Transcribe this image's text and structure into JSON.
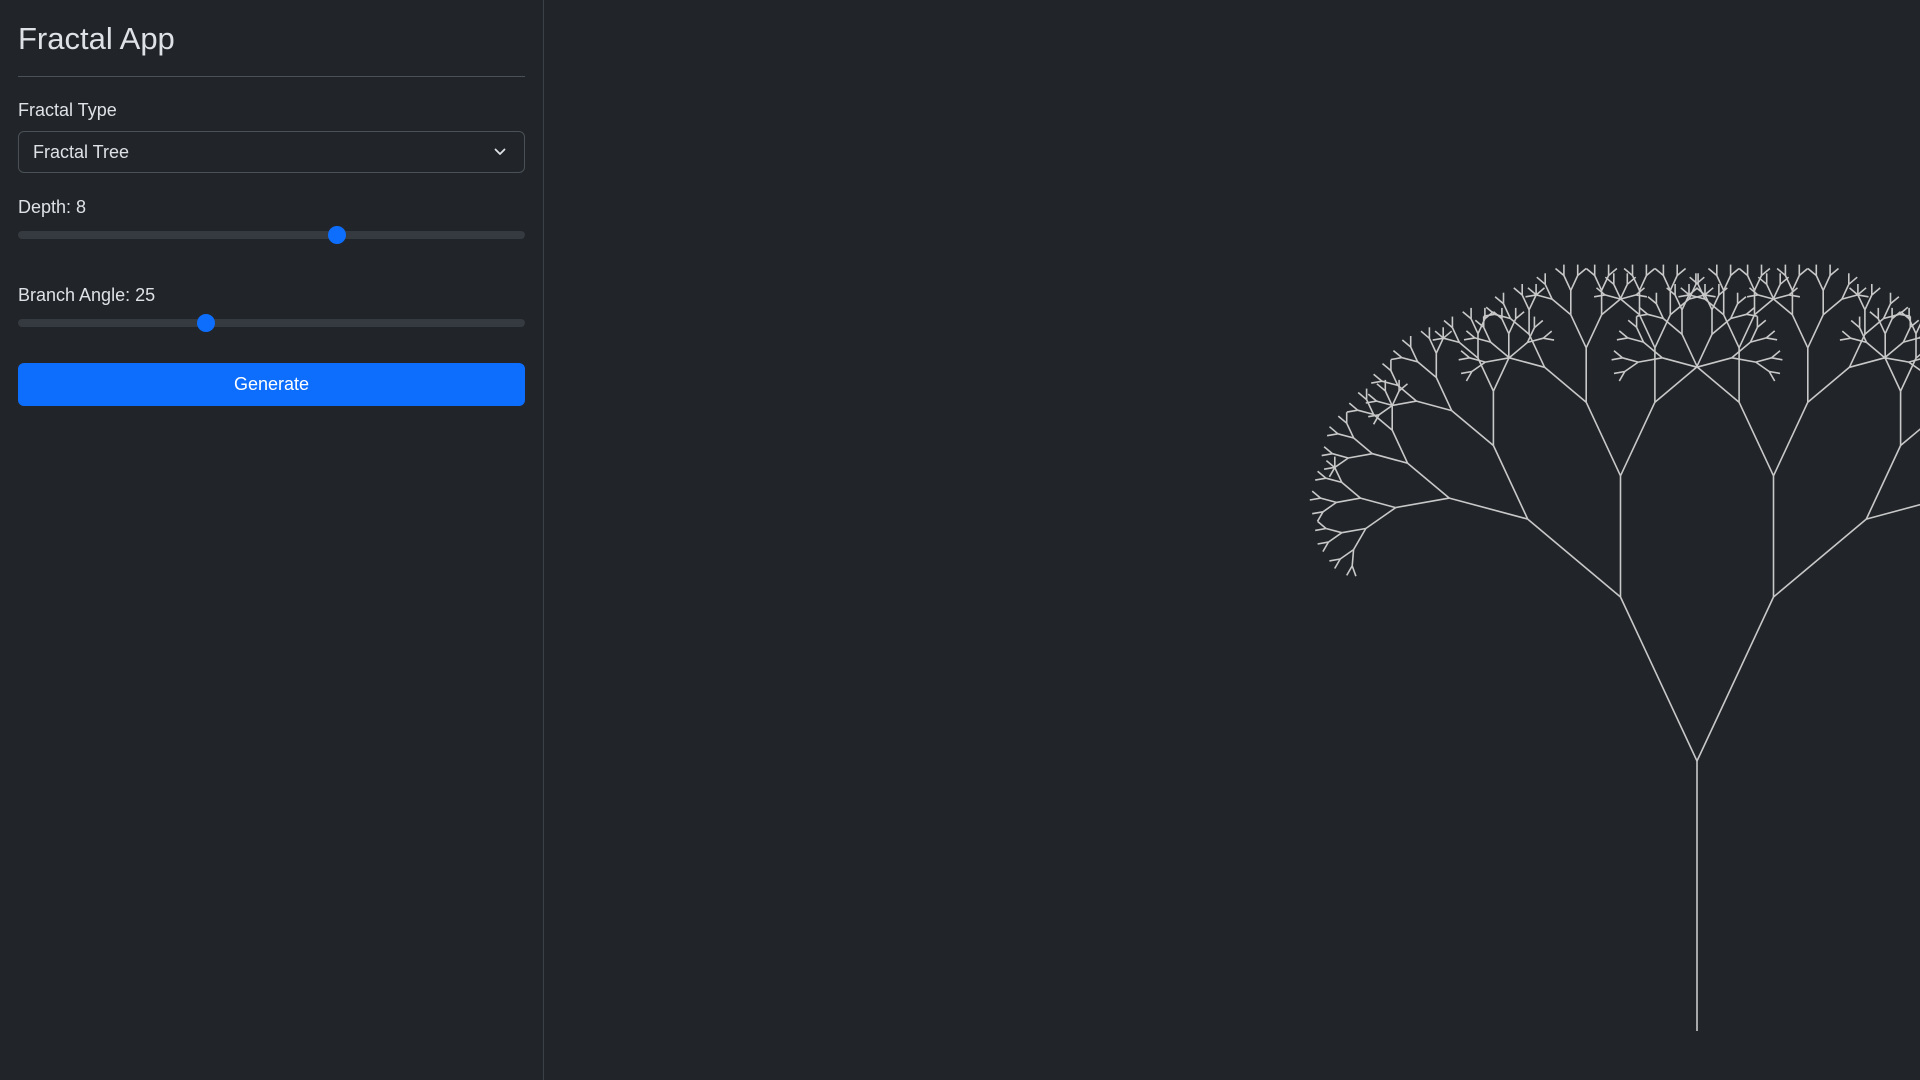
{
  "app": {
    "title": "Fractal App"
  },
  "controls": {
    "fractal_type_label": "Fractal Type",
    "fractal_type_value": "Fractal Tree",
    "depth_label": "Depth: 8",
    "depth_value": 8,
    "depth_fraction": 0.63,
    "angle_label": "Branch Angle: 25",
    "angle_value": 25,
    "angle_fraction": 0.37,
    "generate_label": "Generate"
  },
  "fractal": {
    "type": "tree",
    "depth": 8,
    "branch_angle_deg": 25,
    "length_ratio": 0.67,
    "line_color": "#c8c8c8",
    "background_color": "#212529"
  },
  "colors": {
    "accent": "#0d6efd",
    "background": "#212529",
    "track": "#343a40",
    "border": "#495057"
  },
  "icons": {
    "select_chevron": "chevron-down-icon"
  }
}
